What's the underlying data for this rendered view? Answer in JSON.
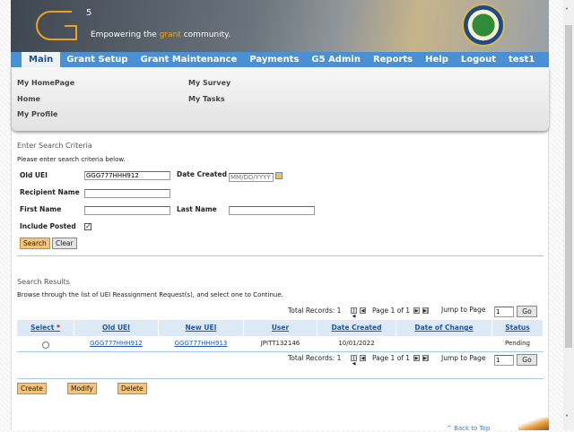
{
  "header": {
    "logo": "G5",
    "tagline_pre": "Empowering the ",
    "tagline_accent": "grant",
    "tagline_post": " community.",
    "seal": "Department of Education seal",
    "accent": "#f0a020"
  },
  "nav": {
    "items": [
      "Main",
      "Grant Setup",
      "Grant Maintenance",
      "Payments",
      "G5 Admin",
      "Reports",
      "Help",
      "Logout",
      "test1"
    ],
    "active": "Main"
  },
  "submenu": {
    "items": [
      "My HomePage",
      "Home",
      "My Profile",
      "My Survey",
      "My Tasks"
    ]
  },
  "search": {
    "title": "Enter Search Criteria",
    "instructions": "Please enter search criteria below.",
    "old_uei_label": "Old UEI",
    "old_uei_value": "GGG777HHH912",
    "date_created_label": "Date Created",
    "date_placeholder": "MM/DD/YYYY",
    "recipient_label": "Recipient Name",
    "first_name_label": "First Name",
    "last_name_label": "Last Name",
    "include_posted_label": "Include Posted",
    "include_posted": true,
    "search_btn": "Search",
    "clear_btn": "Clear"
  },
  "results": {
    "title": "Search Results",
    "instructions": "Browse through the list of UEI Reassignment Request(s), and select one to Continue.",
    "total": "Total Records: 1",
    "page": "Page 1 of 1",
    "jump": "Jump to Page",
    "jump_value": "1",
    "go": "Go",
    "columns": [
      "Select",
      "Old UEI",
      "New UEI",
      "User",
      "Date Created",
      "Date of Change",
      "Status"
    ],
    "required_mark": "*",
    "rows": [
      {
        "old_uei": "GGG777HHH912",
        "new_uei": "GGG777HHH913",
        "user": "JPITT132146",
        "date_created": "10/01/2022",
        "date_of_change": "",
        "status": "Pending"
      }
    ]
  },
  "actions": {
    "create": "Create",
    "modify": "Modify",
    "delete": "Delete"
  },
  "footer": {
    "back_to_top": "^ Back to Top"
  }
}
